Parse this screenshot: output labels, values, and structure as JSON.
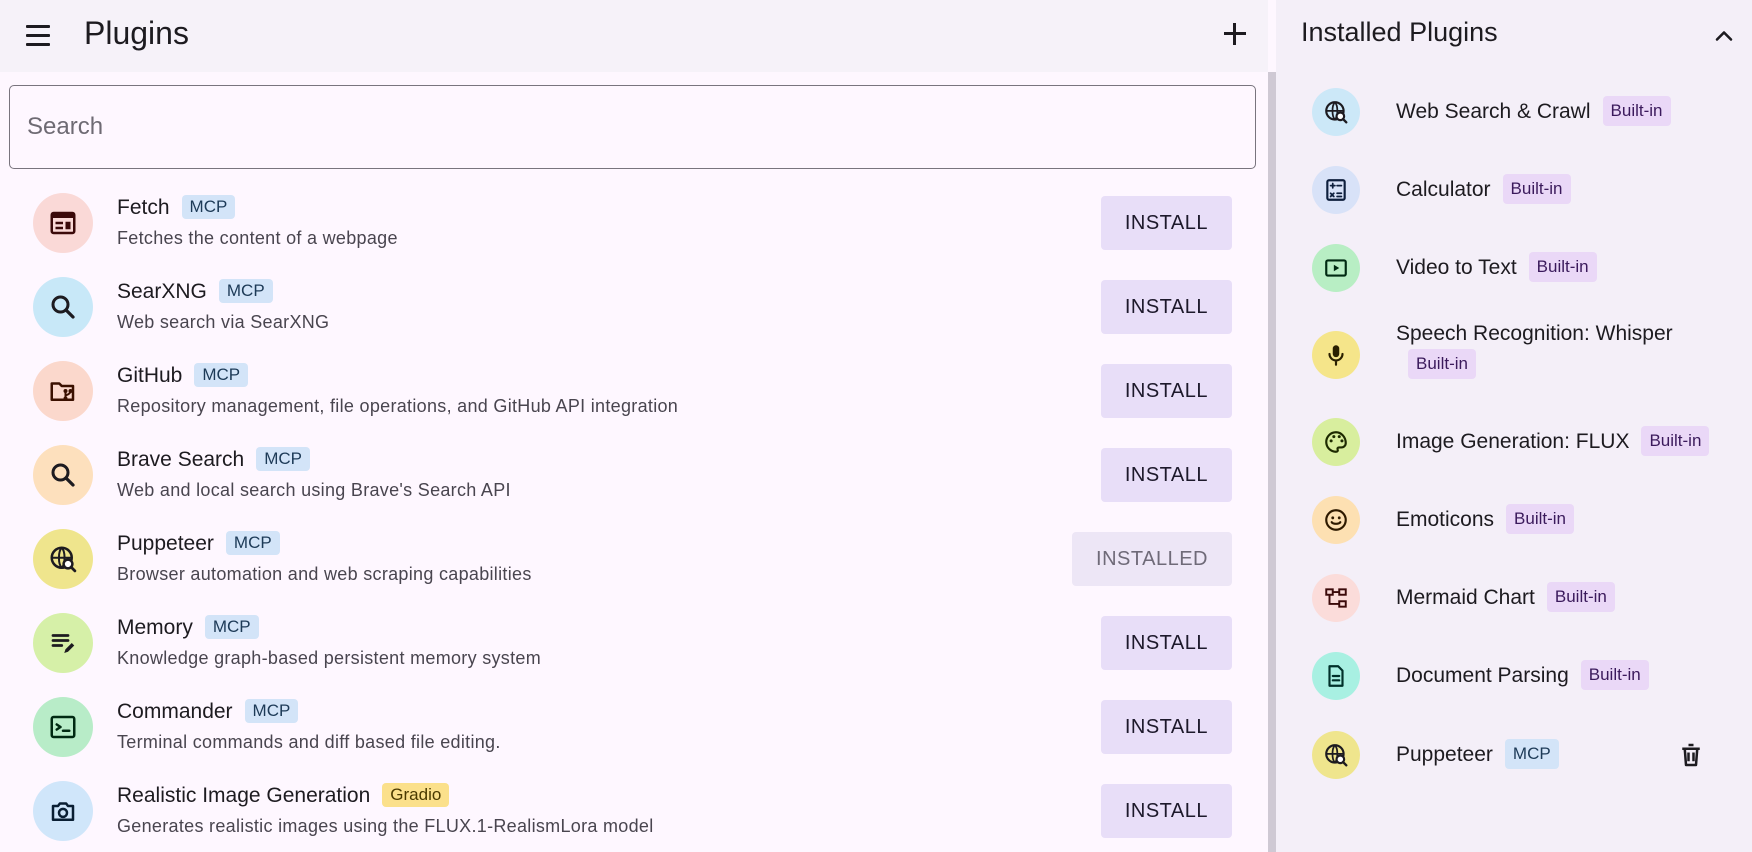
{
  "header": {
    "title": "Plugins"
  },
  "search": {
    "placeholder": "Search"
  },
  "plugins": [
    {
      "name": "Fetch",
      "tag": "MCP",
      "description": "Fetches the content of a webpage",
      "button": "INSTALL",
      "icon": "web-page-icon",
      "color": "#fad9d7"
    },
    {
      "name": "SearXNG",
      "tag": "MCP",
      "description": "Web search via SearXNG",
      "button": "INSTALL",
      "icon": "search-icon",
      "color": "#c8e8f8"
    },
    {
      "name": "GitHub",
      "tag": "MCP",
      "description": "Repository management, file operations, and GitHub API integration",
      "button": "INSTALL",
      "icon": "folder-branch-icon",
      "color": "#fbd8cc"
    },
    {
      "name": "Brave Search",
      "tag": "MCP",
      "description": "Web and local search using Brave's Search API",
      "button": "INSTALL",
      "icon": "search-icon",
      "color": "#fde0bd"
    },
    {
      "name": "Puppeteer",
      "tag": "MCP",
      "description": "Browser automation and web scraping capabilities",
      "button": "INSTALLED",
      "icon": "globe-search-icon",
      "color": "#efe58d"
    },
    {
      "name": "Memory",
      "tag": "MCP",
      "description": "Knowledge graph-based persistent memory system",
      "button": "INSTALL",
      "icon": "edit-note-icon",
      "color": "#d6f0a8"
    },
    {
      "name": "Commander",
      "tag": "MCP",
      "description": "Terminal commands and diff based file editing.",
      "button": "INSTALL",
      "icon": "terminal-icon",
      "color": "#b8ecc8"
    },
    {
      "name": "Realistic Image Generation",
      "tag": "Gradio",
      "description": "Generates realistic images using the FLUX.1-RealismLora model",
      "button": "INSTALL",
      "icon": "camera-icon",
      "color": "#d0e6fa"
    }
  ],
  "installed": {
    "title": "Installed Plugins",
    "items": [
      {
        "name": "Web Search & Crawl",
        "tag": "Built-in",
        "icon": "globe-search-icon",
        "color": "#cce8f8"
      },
      {
        "name": "Calculator",
        "tag": "Built-in",
        "icon": "calculator-icon",
        "color": "#d8e2f8"
      },
      {
        "name": "Video to Text",
        "tag": "Built-in",
        "icon": "video-icon",
        "color": "#b8eec4"
      },
      {
        "name": "Speech Recognition: Whisper",
        "tag": "Built-in",
        "icon": "microphone-icon",
        "color": "#f5e58a"
      },
      {
        "name": "Image Generation: FLUX",
        "tag": "Built-in",
        "icon": "palette-icon",
        "color": "#d8ee9e"
      },
      {
        "name": "Emoticons",
        "tag": "Built-in",
        "icon": "smiley-icon",
        "color": "#fde0b2"
      },
      {
        "name": "Mermaid Chart",
        "tag": "Built-in",
        "icon": "flowchart-icon",
        "color": "#fbdcda"
      },
      {
        "name": "Document Parsing",
        "tag": "Built-in",
        "icon": "document-icon",
        "color": "#a8f0e2"
      },
      {
        "name": "Puppeteer",
        "tag": "MCP",
        "icon": "globe-search-icon",
        "color": "#efe58d"
      }
    ]
  }
}
